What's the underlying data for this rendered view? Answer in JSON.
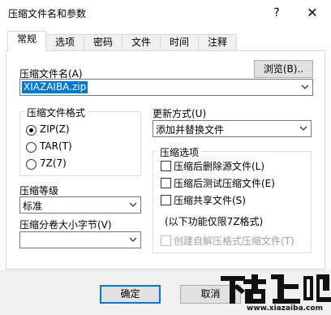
{
  "window": {
    "title": "压缩文件名和参数",
    "help": "?",
    "close": "✕"
  },
  "tabs": [
    "常规",
    "选项",
    "密码",
    "文件",
    "时间",
    "注释"
  ],
  "archive": {
    "label": "压缩文件名(A)",
    "browse": "浏览(B)..",
    "value": "XIAZAIBA.zip"
  },
  "format": {
    "title": "压缩文件格式",
    "options": [
      "ZIP(Z)",
      "TAR(T)",
      "7Z(7)"
    ],
    "selected": 0
  },
  "update": {
    "label": "更新方式(U)",
    "value": "添加并替换文件"
  },
  "level": {
    "label": "压缩等级",
    "value": "标准"
  },
  "volume": {
    "label": "压缩分卷大小字节(V)",
    "value": ""
  },
  "options": {
    "title": "压缩选项",
    "items": [
      "压缩后删除源文件(L)",
      "压缩后测试压缩文件(E)",
      "压缩共享文件(S)"
    ],
    "note": "(以下功能仅限7Z格式)",
    "disabled_item": "创建自解压格式压缩文件(T)"
  },
  "buttons": {
    "ok": "确定",
    "cancel": "取消"
  },
  "watermark": {
    "big": "下载吧",
    "url": "www.xiazaiba.com"
  },
  "colors": {
    "accent": "#0078d7",
    "selection": "#0078d7",
    "face": "#f0f0f0"
  }
}
